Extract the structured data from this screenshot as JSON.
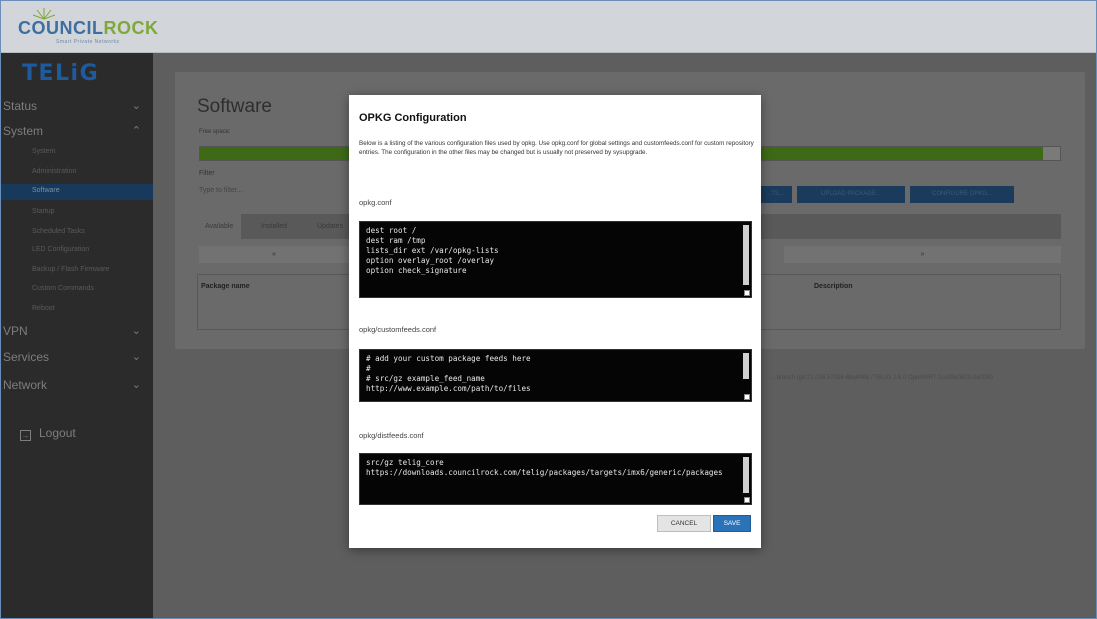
{
  "header": {
    "brand_part1": "COUNCIL",
    "brand_part2": "ROCK",
    "brand_tagline": "Smart Private Networks"
  },
  "sidebar": {
    "logo": "TELiG",
    "groups": [
      {
        "label": "Status",
        "chevron": "chevron-down-icon"
      },
      {
        "label": "System",
        "chevron": "chevron-up-icon"
      },
      {
        "label": "VPN",
        "chevron": "chevron-down-icon"
      },
      {
        "label": "Services",
        "chevron": "chevron-down-icon"
      },
      {
        "label": "Network",
        "chevron": "chevron-down-icon"
      }
    ],
    "system_items": [
      "System",
      "Administration",
      "Software",
      "Startup",
      "Scheduled Tasks",
      "LED Configuration",
      "Backup / Flash Firmware",
      "Custom Commands",
      "Reboot"
    ],
    "active_item": "Software",
    "logout": "Logout"
  },
  "software": {
    "title": "Software",
    "free_space_label": "Free space:",
    "free_space_fraction": 0.98,
    "filter_label": "Filter",
    "filter_placeholder": "Type to filter...",
    "btn_lists": "...TS...",
    "btn_upload": "UPLOAD PACKAGE...",
    "btn_configure": "CONFIGURE OPKG...",
    "tabs": [
      "Available",
      "Installed",
      "Updates"
    ],
    "pager_left": "«",
    "pager_right": "»",
    "col_package": "Package name",
    "col_description": "Description",
    "footer": "... branch (git-21.016.57036-6ba8f49) / TELiG 2.6.0 OpenWRT 1ce93a0823-0a0290"
  },
  "modal": {
    "title": "OPKG Configuration",
    "description": "Below is a listing of the various configuration files used by opkg. Use opkg.conf for global settings and customfeeds.conf for custom repository entries. The configuration in the other files may be changed but is usually not preserved by sysupgrade.",
    "files": [
      {
        "name": "opkg.conf",
        "content": "dest root /\ndest ram /tmp\nlists_dir ext /var/opkg-lists\noption overlay_root /overlay\noption check_signature"
      },
      {
        "name": "opkg/customfeeds.conf",
        "content": "# add your custom package feeds here\n#\n# src/gz example_feed_name\nhttp://www.example.com/path/to/files"
      },
      {
        "name": "opkg/distfeeds.conf",
        "content": "src/gz telig_core\nhttps://downloads.councilrock.com/telig/packages/targets/imx6/generic/packages"
      }
    ],
    "cancel_label": "CANCEL",
    "save_label": "SAVE"
  }
}
